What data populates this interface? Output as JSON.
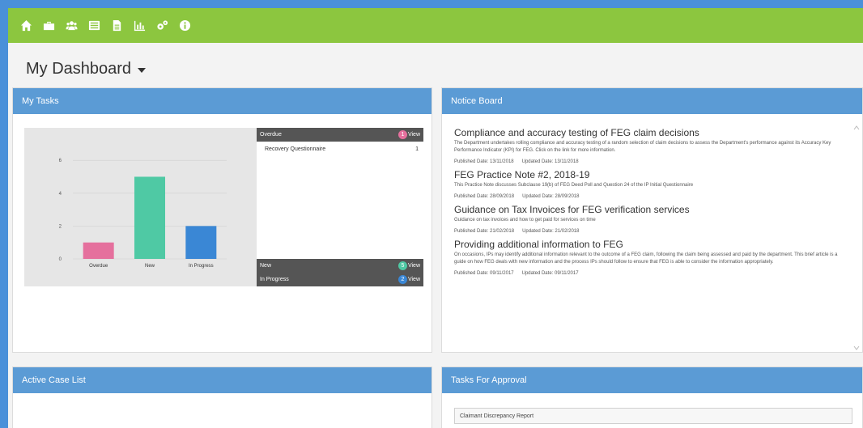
{
  "page": {
    "title": "My Dashboard"
  },
  "nav": {
    "icons": [
      "home-icon",
      "briefcase-icon",
      "users-icon",
      "list-icon",
      "document-icon",
      "bar-chart-icon",
      "settings-icon",
      "info-icon"
    ]
  },
  "colors": {
    "topbar": "#8cc63f",
    "panel_header": "#5b9bd5",
    "overdue": "#e5709d",
    "new": "#4fc9a4",
    "in_progress": "#3a87d5"
  },
  "my_tasks": {
    "header": "My Tasks",
    "rows": {
      "overdue": {
        "label": "Overdue",
        "count": "1",
        "view": "View"
      },
      "new": {
        "label": "New",
        "count": "5",
        "view": "View"
      },
      "in_progress": {
        "label": "In Progress",
        "count": "2",
        "view": "View"
      }
    },
    "overdue_items": [
      {
        "label": "Recovery Questionnaire",
        "count": "1"
      }
    ]
  },
  "chart_data": {
    "type": "bar",
    "categories": [
      "Overdue",
      "New",
      "In Progress"
    ],
    "values": [
      1,
      5,
      2
    ],
    "colors": [
      "#e5709d",
      "#4fc9a4",
      "#3a87d5"
    ],
    "yticks": [
      0,
      2,
      4,
      6
    ],
    "ylim": [
      0,
      6.5
    ],
    "grid": true
  },
  "notice_board": {
    "header": "Notice Board",
    "items": [
      {
        "title": "Compliance and accuracy testing of FEG claim decisions",
        "desc": "The Department undertakes rolling compliance and accuracy testing of a random selection of claim decisions to assess the Department's performance against its Accuracy Key Performance Indicator (KPI) for FEG. Click on the link for more information.",
        "published": "Published Date: 13/11/2018",
        "updated": "Updated Date: 13/11/2018"
      },
      {
        "title": "FEG Practice Note #2, 2018-19",
        "desc": "This Practice Note discusses Subclause 19(b) of FEG Deed Poll and Question 24 of the IP Initial Questionnaire",
        "published": "Published Date: 28/09/2018",
        "updated": "Updated Date: 28/09/2018"
      },
      {
        "title": "Guidance on Tax Invoices for FEG verification services",
        "desc": "Guidance on tax invoices and how to get paid for services on time",
        "published": "Published Date: 21/02/2018",
        "updated": "Updated Date: 21/02/2018"
      },
      {
        "title": "Providing additional information to FEG",
        "desc": "On occasions, IPs may identify additional information relevant to the outcome of a FEG claim, following the claim being assessed and paid by the department. This brief article is a guide on how FEG deals with new information and the process IPs should follow to ensure that FEG is able to consider the information appropriately.",
        "published": "Published Date: 09/11/2017",
        "updated": "Updated Date: 09/11/2017"
      }
    ]
  },
  "active_case_list": {
    "header": "Active Case List"
  },
  "tasks_for_approval": {
    "header": "Tasks For Approval",
    "items": [
      "Claimant Discrepancy Report"
    ]
  }
}
